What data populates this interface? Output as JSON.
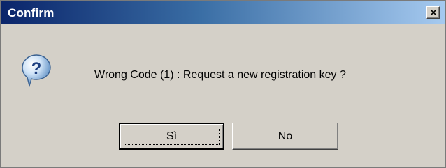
{
  "dialog": {
    "title": "Confirm",
    "message": "Wrong Code (1) : Request a new registration key ?",
    "icon": "question-icon",
    "close_icon": "close-icon",
    "buttons": {
      "yes_label": "Sì",
      "no_label": "No"
    }
  },
  "colors": {
    "titlebar_start": "#0a246a",
    "titlebar_end": "#a6caf0",
    "window_bg": "#d4d0c8"
  }
}
